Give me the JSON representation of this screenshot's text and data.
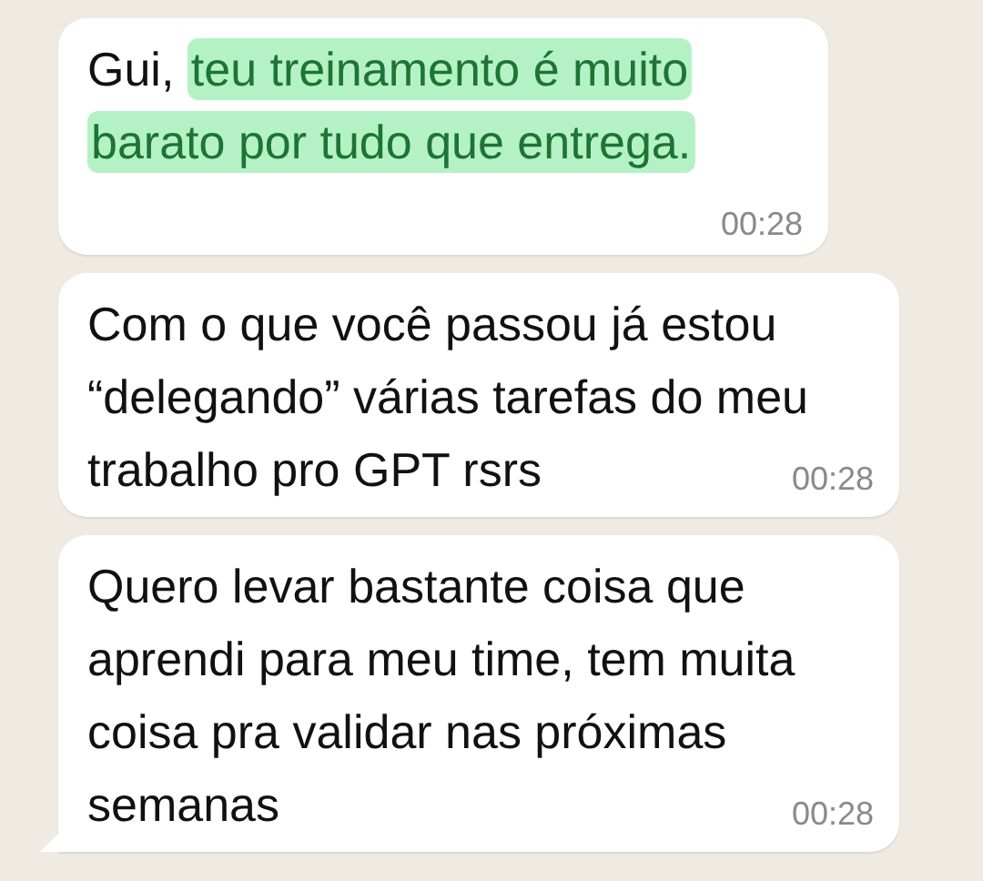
{
  "messages": [
    {
      "segments": [
        {
          "text": "Gui, ",
          "highlighted": false
        },
        {
          "text": "teu treinamento é muito barato por tudo que entrega.",
          "highlighted": true
        }
      ],
      "time": "00:28",
      "tail": false
    },
    {
      "segments": [
        {
          "text": "Com o que você passou já estou “delegando” várias tarefas do meu trabalho pro GPT rsrs",
          "highlighted": false
        }
      ],
      "time": "00:28",
      "tail": false
    },
    {
      "segments": [
        {
          "text": "Quero levar bastante coisa que aprendi para meu time, tem muita coisa pra validar nas próximas semanas",
          "highlighted": false
        }
      ],
      "time": "00:28",
      "tail": true
    }
  ]
}
